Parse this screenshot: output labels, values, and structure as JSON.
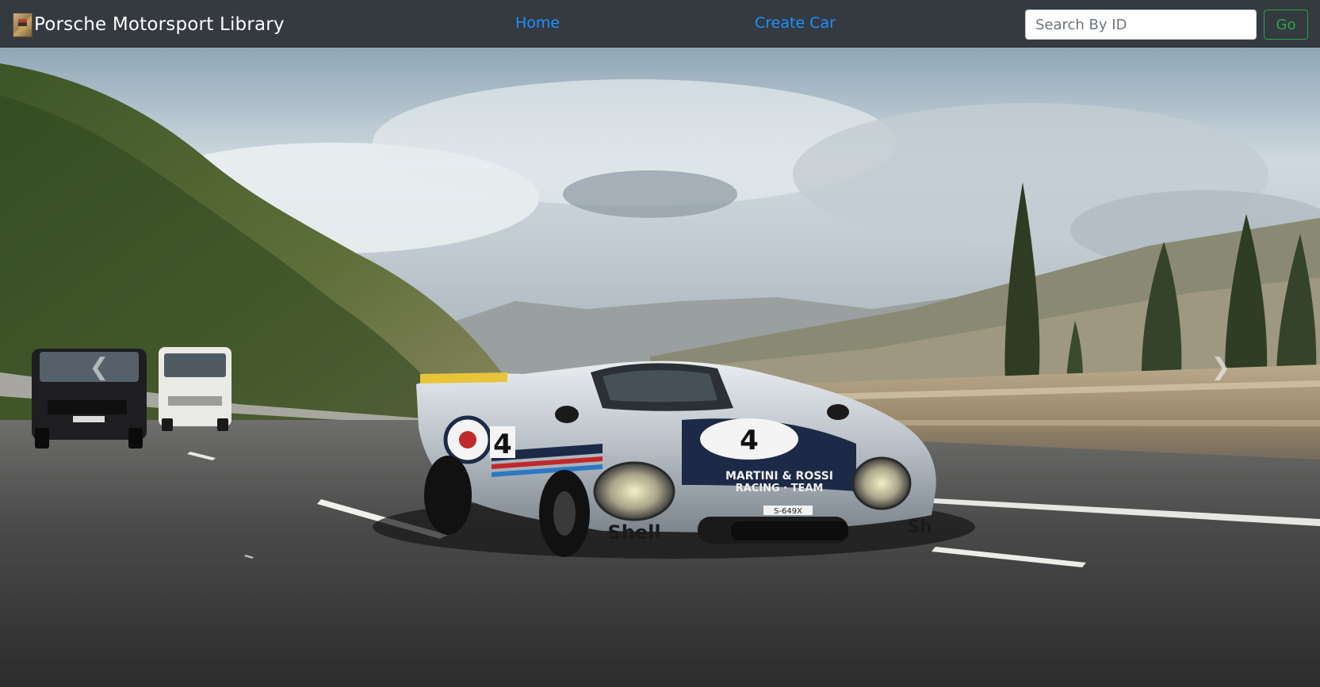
{
  "navbar": {
    "brand": "Porsche Motorsport Library",
    "links": [
      {
        "label": "Home"
      },
      {
        "label": "Create Car"
      }
    ],
    "search": {
      "placeholder": "Search By ID",
      "value": ""
    },
    "go_label": "Go"
  },
  "carousel": {
    "hero_image": "porsche-917k-martini-racing-car-on-highway",
    "car_number": "4",
    "car_livery_text": "MARTINI & ROSSI RACING · TEAM",
    "sponsor": "Shell",
    "plate": "S-649X",
    "prev_icon": "chevron-left-icon",
    "next_icon": "chevron-right-icon"
  },
  "colors": {
    "navbar_bg": "#343a40",
    "link": "#1e90ff",
    "go_button": "#28a745",
    "brand_text": "#ffffff"
  }
}
